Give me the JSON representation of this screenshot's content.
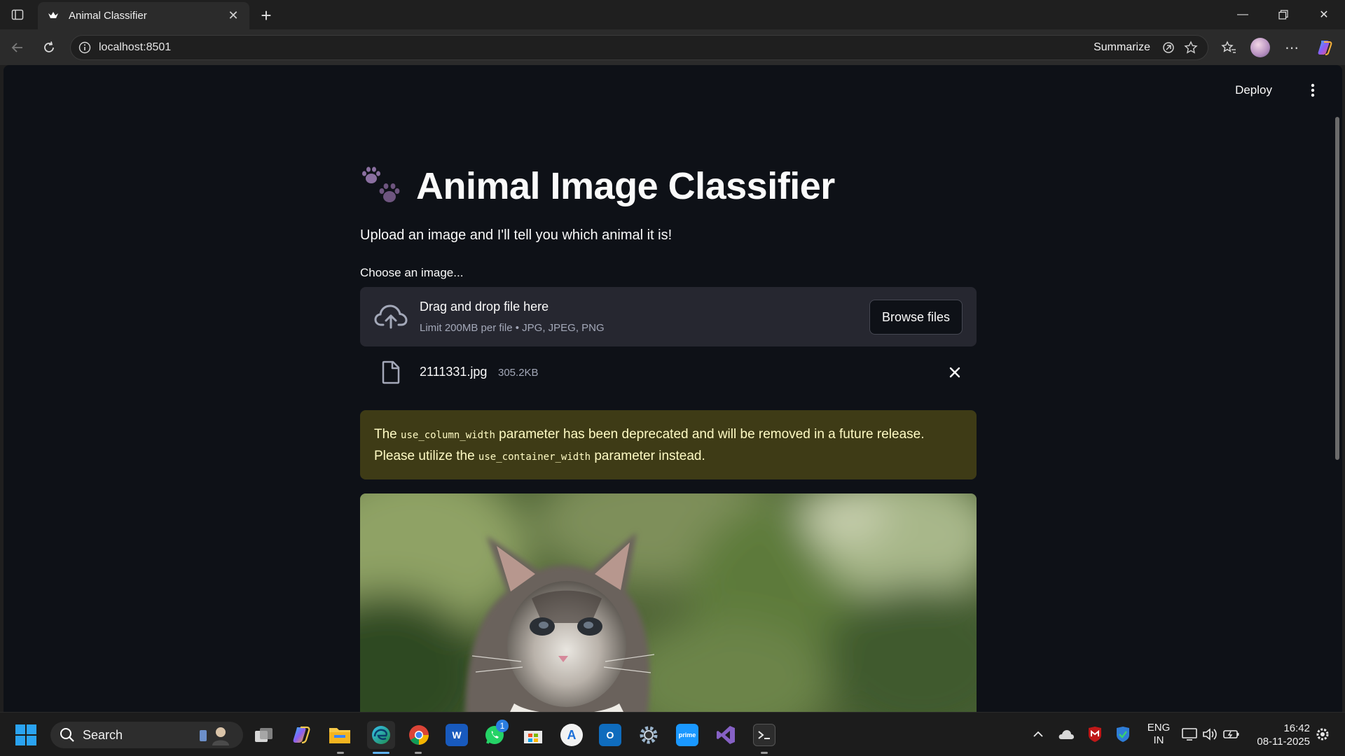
{
  "browser": {
    "tab_title": "Animal Classifier",
    "url": "localhost:8501",
    "summarize_label": "Summarize"
  },
  "toolbar": {
    "deploy_label": "Deploy"
  },
  "app": {
    "title": "Animal Image Classifier",
    "subtitle": "Upload an image and I'll tell you which animal it is!",
    "uploader_label": "Choose an image...",
    "dropzone_title": "Drag and drop file here",
    "dropzone_limit": "Limit 200MB per file • JPG, JPEG, PNG",
    "browse_label": "Browse files",
    "file": {
      "name": "2111331.jpg",
      "size": "305.2KB"
    },
    "warning": {
      "part1": "The ",
      "code1": "use_column_width",
      "part2": " parameter has been deprecated and will be removed in a future release. Please utilize the ",
      "code2": "use_container_width",
      "part3": " parameter instead."
    }
  },
  "taskbar": {
    "search_label": "Search",
    "lang_line1": "ENG",
    "lang_line2": "IN",
    "time": "16:42",
    "date": "08-11-2025",
    "whatsapp_badge": "1"
  },
  "colors": {
    "page_bg": "#0e1117",
    "widget_bg": "#262730",
    "warning_bg": "#3e3b16",
    "warning_text": "#fffbc4"
  }
}
